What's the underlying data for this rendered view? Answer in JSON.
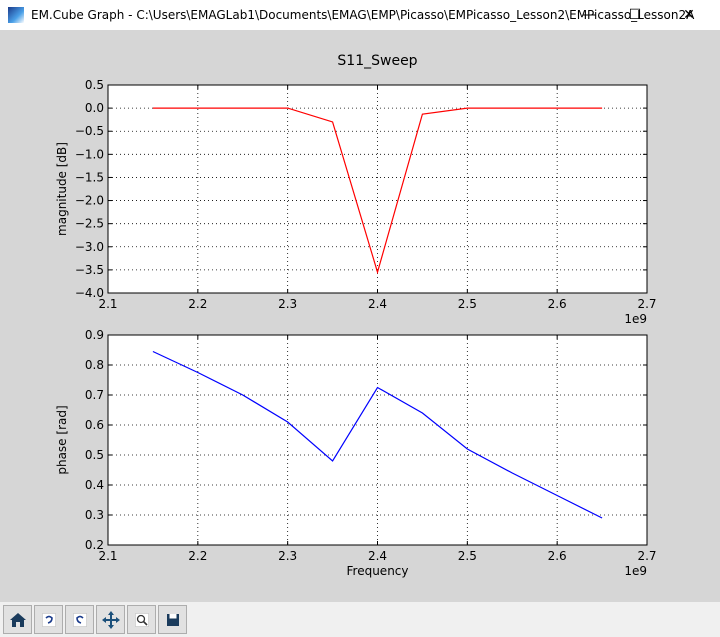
{
  "window": {
    "title": "EM.Cube Graph - C:\\Users\\EMAGLab1\\Documents\\EMAG\\EMP\\Picasso\\EMPicasso_Lesson2\\EMPicasso_Lesson2A",
    "controls": {
      "minimize": "—",
      "maximize": "☐",
      "close": "✕"
    }
  },
  "toolbar": {
    "buttons": [
      {
        "name": "home-button",
        "icon": "home-icon"
      },
      {
        "name": "back-button",
        "icon": "back-icon"
      },
      {
        "name": "forward-button",
        "icon": "forward-icon"
      },
      {
        "name": "pan-button",
        "icon": "pan-icon"
      },
      {
        "name": "zoom-button",
        "icon": "zoom-icon"
      },
      {
        "name": "save-button",
        "icon": "save-icon"
      }
    ]
  },
  "chart_data": [
    {
      "type": "line",
      "title": "S11_Sweep",
      "xlabel": "",
      "ylabel": "magnitude [dB]",
      "x_offset_label": "1e9",
      "xlim": [
        2.1,
        2.7
      ],
      "ylim": [
        -4.0,
        0.5
      ],
      "xticks": [
        "2.1",
        "2.2",
        "2.3",
        "2.4",
        "2.5",
        "2.6",
        "2.7"
      ],
      "yticks": [
        "0.5",
        "0.0",
        "−0.5",
        "−1.0",
        "−1.5",
        "−2.0",
        "−2.5",
        "−3.0",
        "−3.5",
        "−4.0"
      ],
      "grid": true,
      "color": "#ff0000",
      "x": [
        2.15,
        2.2,
        2.25,
        2.3,
        2.35,
        2.4,
        2.45,
        2.5,
        2.55,
        2.6,
        2.65
      ],
      "y": [
        0.0,
        0.0,
        0.0,
        0.0,
        -0.3,
        -3.55,
        -0.13,
        0.0,
        0.0,
        0.0,
        0.0
      ]
    },
    {
      "type": "line",
      "title": "",
      "xlabel": "Frequency",
      "ylabel": "phase [rad]",
      "x_offset_label": "1e9",
      "xlim": [
        2.1,
        2.7
      ],
      "ylim": [
        0.2,
        0.9
      ],
      "xticks": [
        "2.1",
        "2.2",
        "2.3",
        "2.4",
        "2.5",
        "2.6",
        "2.7"
      ],
      "yticks": [
        "0.9",
        "0.8",
        "0.7",
        "0.6",
        "0.5",
        "0.4",
        "0.3",
        "0.2"
      ],
      "grid": true,
      "color": "#0000ff",
      "x": [
        2.15,
        2.2,
        2.25,
        2.3,
        2.35,
        2.4,
        2.45,
        2.5,
        2.55,
        2.6,
        2.65
      ],
      "y": [
        0.845,
        0.775,
        0.7,
        0.61,
        0.48,
        0.725,
        0.64,
        0.52,
        0.44,
        0.365,
        0.29
      ]
    }
  ]
}
